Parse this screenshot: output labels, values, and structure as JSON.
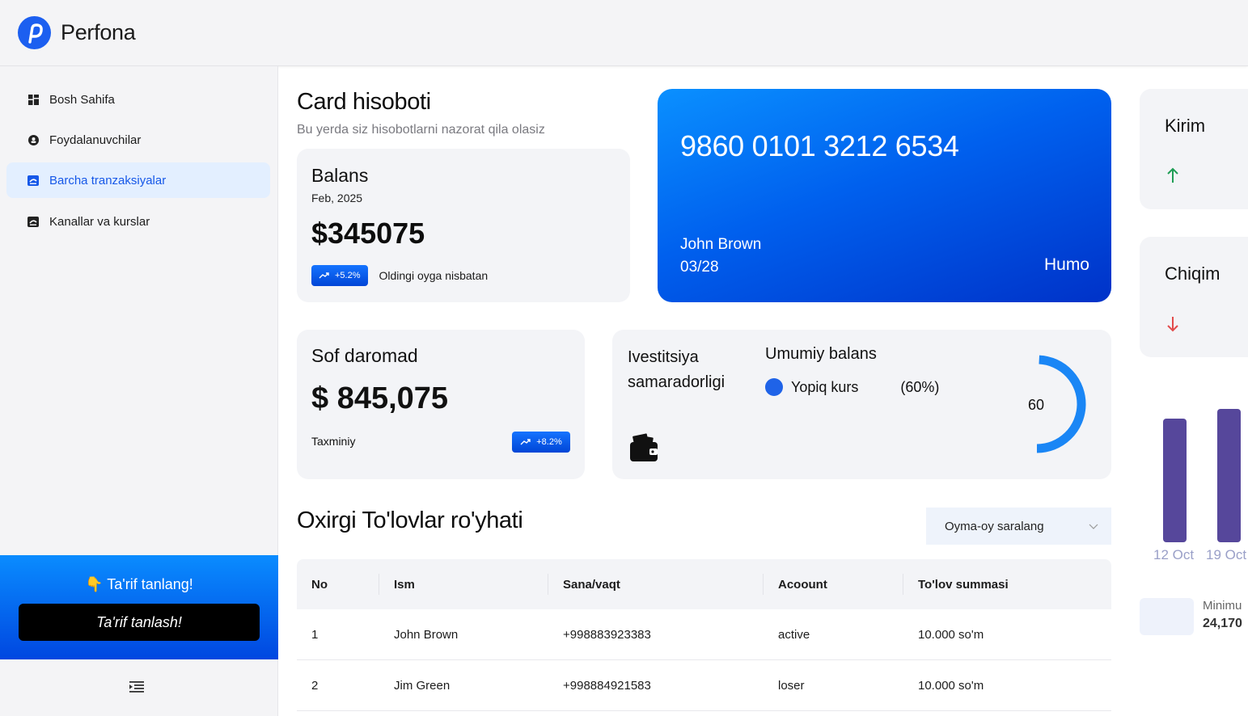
{
  "app": {
    "name": "Perfona"
  },
  "sidebar": {
    "items": [
      {
        "label": "Bosh Sahifa"
      },
      {
        "label": "Foydalanuvchilar"
      },
      {
        "label": "Barcha tranzaksiyalar"
      },
      {
        "label": "Kanallar va kurslar"
      }
    ],
    "promo_title": "👇 Ta'rif tanlang!",
    "promo_button": "Ta'rif tanlash!"
  },
  "header": {
    "title": "Card hisoboti",
    "subtitle": "Bu yerda siz hisobotlarni nazorat qila olasiz"
  },
  "balance": {
    "title": "Balans",
    "date": "Feb, 2025",
    "amount": "$345075",
    "badge": "+5.2%",
    "note": "Oldingi oyga nisbatan"
  },
  "bank_card": {
    "number": "9860 0101 3212 6534",
    "holder": "John Brown",
    "expiry": "03/28",
    "brand": "Humo"
  },
  "net_income": {
    "title": "Sof daromad",
    "amount": "$ 845,075",
    "note": "Taxminiy",
    "badge": "+8.2%"
  },
  "investment": {
    "title_line1": "Ivestitsiya",
    "title_line2": "samaradorligi",
    "balance_title": "Umumiy balans",
    "legend_label": "Yopiq kurs",
    "legend_pct": "(60%)",
    "gauge_value": "60",
    "gauge_fraction": 0.6,
    "colors": {
      "accent": "#1a86f5",
      "dot": "#1f63e8"
    }
  },
  "payments": {
    "title": "Oxirgi To'lovlar ro'yhati",
    "filter": "Oyma-oy saralang",
    "columns": [
      "No",
      "Ism",
      "Sana/vaqt",
      "Acoount",
      "To'lov summasi"
    ],
    "rows": [
      [
        "1",
        "John Brown",
        "+998883923383",
        "active",
        "10.000 so'm"
      ],
      [
        "2",
        "Jim Green",
        "+998884921583",
        "loser",
        "10.000 so'm"
      ]
    ]
  },
  "right_panel": {
    "income_title": "Kirim",
    "expense_title": "Chiqim",
    "bar_labels": [
      "12 Oct",
      "19 Oct"
    ],
    "bar_levels": [
      0.9,
      0.97
    ],
    "bar_color": "#56479b",
    "min_label": "Minimu",
    "min_value": "24,170"
  }
}
